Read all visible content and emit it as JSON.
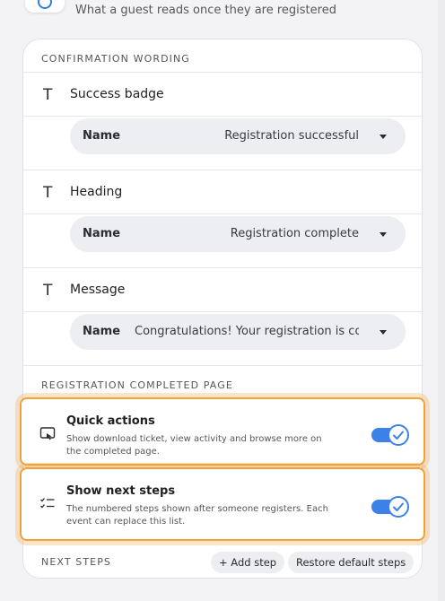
{
  "top": {
    "subtitle": "What a guest reads once they are registered"
  },
  "confirmation": {
    "section_label": "CONFIRMATION WORDING",
    "fields": [
      {
        "title": "Success badge",
        "name_label": "Name",
        "value": "Registration successful"
      },
      {
        "title": "Heading",
        "name_label": "Name",
        "value": "Registration complete"
      },
      {
        "title": "Message",
        "name_label": "Name",
        "value": "Congratulations! Your registration is co"
      }
    ],
    "field_icon_glyph": "T"
  },
  "completed_page": {
    "section_label": "REGISTRATION COMPLETED PAGE",
    "toggles": [
      {
        "title": "Quick actions",
        "description": "Show download ticket, view activity and browse more on the completed page.",
        "icon": "touch-screen-icon",
        "enabled": true
      },
      {
        "title": "Show next steps",
        "description": "The numbered steps shown after someone registers. Each event can replace this list.",
        "icon": "checklist-icon",
        "enabled": true
      }
    ]
  },
  "next_steps": {
    "section_label": "NEXT STEPS",
    "add_label": "+ Add step",
    "restore_label": "Restore default steps"
  },
  "colors": {
    "accent": "#3a82e8",
    "highlight": "#f0a23c",
    "background": "#f3f3f5"
  }
}
